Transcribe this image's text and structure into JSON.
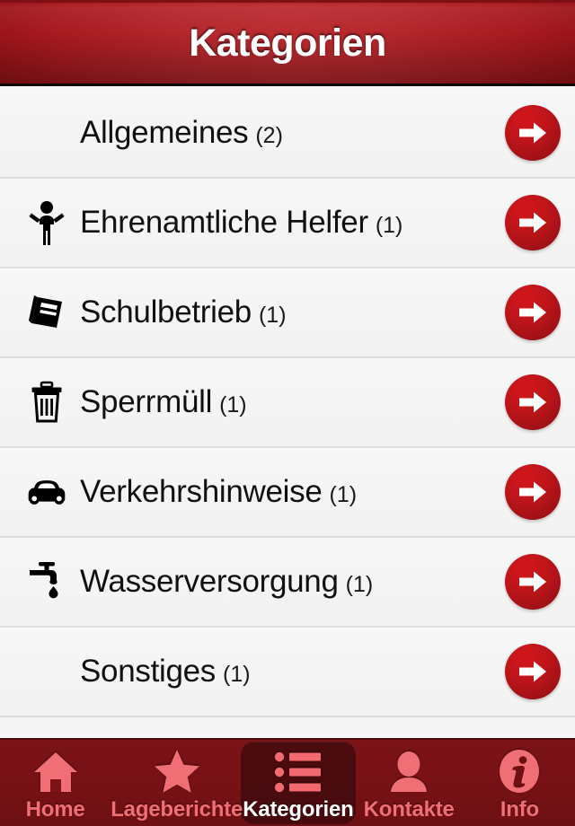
{
  "header": {
    "title": "Kategorien"
  },
  "colors": {
    "brand_red": "#b5272c",
    "header_dark": "#9c1419",
    "tabbar_bg": "#7b1317",
    "tab_inactive": "#ef6f74",
    "tab_active_label": "#ffffff",
    "arrow_button": "#c0151a",
    "row_bg": "#f5f5f5",
    "row_separator": "#dcdcdc"
  },
  "list": {
    "rows": [
      {
        "label": "Allgemeines",
        "count": "(2)",
        "icon": "none",
        "arrow": "arrow-right-icon"
      },
      {
        "label": "Ehrenamtliche Helfer",
        "count": "(1)",
        "icon": "person-raised-arms-icon",
        "arrow": "arrow-right-icon"
      },
      {
        "label": "Schulbetrieb",
        "count": "(1)",
        "icon": "book-icon",
        "arrow": "arrow-right-icon"
      },
      {
        "label": "Sperrmüll",
        "count": "(1)",
        "icon": "trash-icon",
        "arrow": "arrow-right-icon"
      },
      {
        "label": "Verkehrshinweise",
        "count": "(1)",
        "icon": "car-icon",
        "arrow": "arrow-right-icon"
      },
      {
        "label": "Wasserversorgung",
        "count": "(1)",
        "icon": "faucet-icon",
        "arrow": "arrow-right-icon"
      },
      {
        "label": "Sonstiges",
        "count": "(1)",
        "icon": "none",
        "arrow": "arrow-right-icon"
      }
    ]
  },
  "tabbar": {
    "tabs": [
      {
        "label": "Home",
        "icon": "home-icon",
        "active": false
      },
      {
        "label": "Lageberichte",
        "icon": "star-icon",
        "active": false
      },
      {
        "label": "Kategorien",
        "icon": "list-icon",
        "active": true
      },
      {
        "label": "Kontakte",
        "icon": "person-icon",
        "active": false
      },
      {
        "label": "Info",
        "icon": "info-icon",
        "active": false
      }
    ]
  }
}
